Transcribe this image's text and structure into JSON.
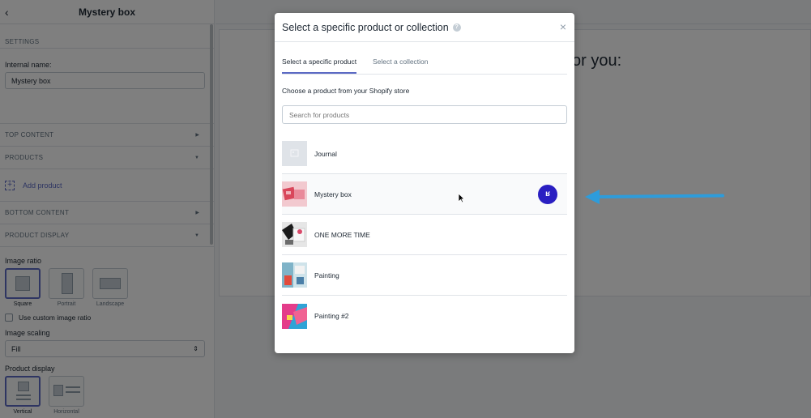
{
  "sidebar": {
    "title": "Mystery box",
    "settings_label": "SETTINGS",
    "internal_name_label": "Internal name:",
    "internal_name_value": "Mystery box",
    "sections": {
      "top_content": "TOP CONTENT",
      "products": "PRODUCTS",
      "bottom_content": "BOTTOM CONTENT",
      "product_display": "PRODUCT DISPLAY"
    },
    "add_product": "Add product",
    "image_ratio_label": "Image ratio",
    "image_ratio_options": [
      "Square",
      "Portrait",
      "Landscape"
    ],
    "image_ratio_selected": "Square",
    "custom_ratio_label": "Use custom image ratio",
    "image_scaling_label": "Image scaling",
    "image_scaling_value": "Fill",
    "product_display_label": "Product display",
    "product_display_options": [
      "Vertical",
      "Horizontal"
    ],
    "product_display_selected": "Vertical"
  },
  "background": {
    "heading_fragment": "or you:"
  },
  "modal": {
    "title": "Select a specific product or collection",
    "tabs": [
      "Select a specific product",
      "Select a collection"
    ],
    "active_tab": "Select a specific product",
    "instruction": "Choose a product from your Shopify store",
    "search_placeholder": "Search for products",
    "products": [
      {
        "name": "Journal"
      },
      {
        "name": "Mystery box"
      },
      {
        "name": "ONE MORE TIME"
      },
      {
        "name": "Painting"
      },
      {
        "name": "Painting #2"
      }
    ]
  },
  "colors": {
    "accent": "#5c6ac4",
    "badge": "#2a1fc2",
    "annotation_arrow": "#2d9cdb"
  }
}
